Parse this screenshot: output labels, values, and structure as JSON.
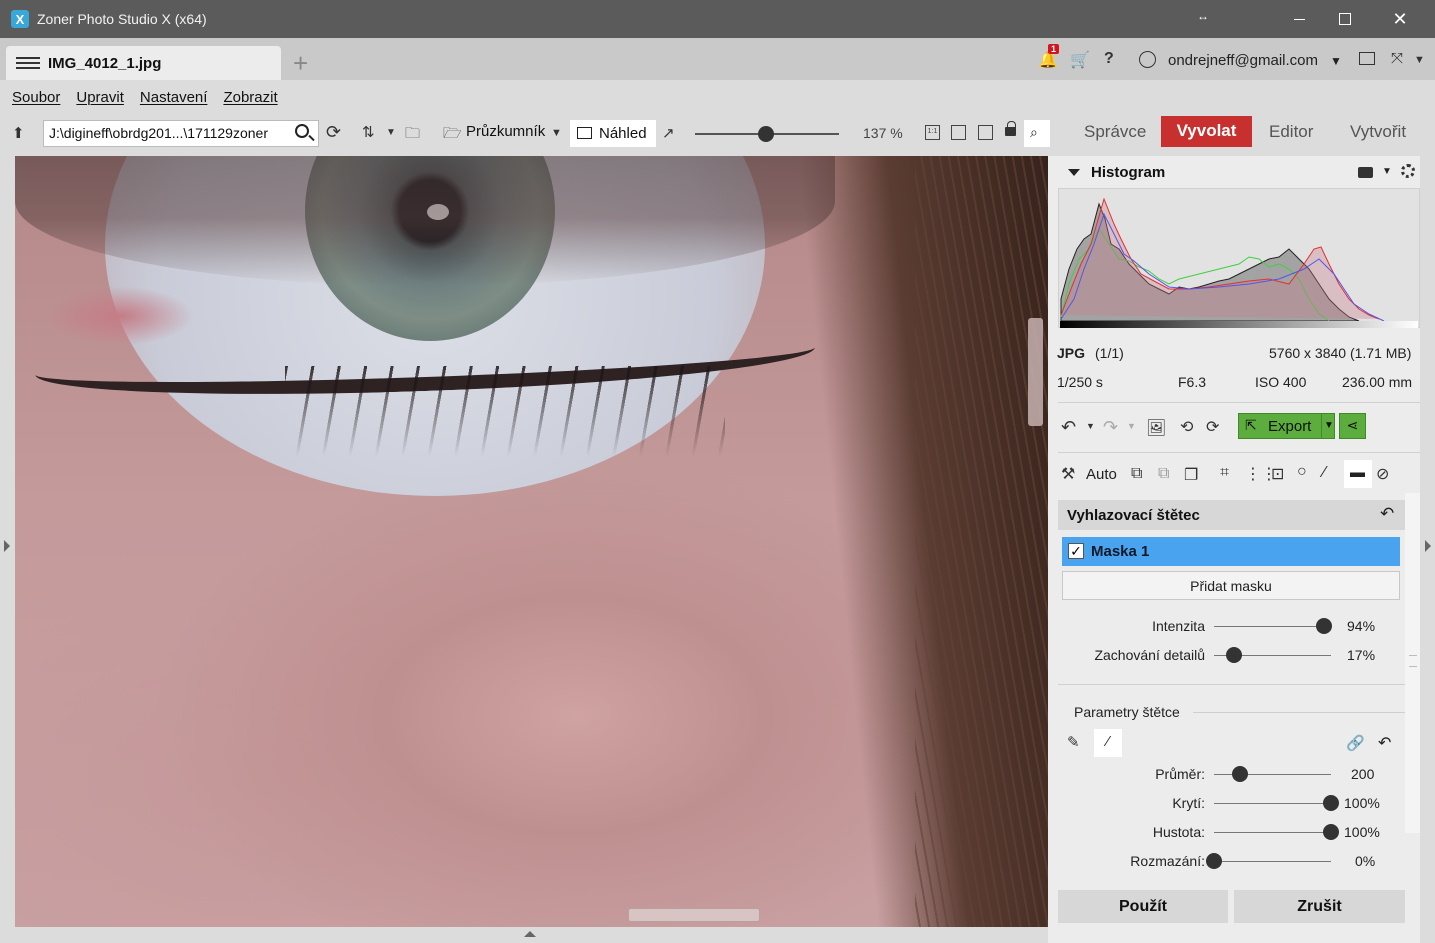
{
  "window": {
    "title": "Zoner Photo Studio X (x64)",
    "logo_letter": "X"
  },
  "tabs": {
    "active_tab": "IMG_4012_1.jpg",
    "new_tab_symbol": "+"
  },
  "account": {
    "notification_count": "1",
    "email": "ondrejneff@gmail.com"
  },
  "menu": [
    "Soubor",
    "Upravit",
    "Nastavení",
    "Zobrazit"
  ],
  "toolbar": {
    "path": "J:\\digineff\\obrdg201...\\171129zoner",
    "browser_label": "Průzkumník",
    "preview_label": "Náhled",
    "zoom_value": "137 %",
    "zoom_fraction": 0.49,
    "actual_size_label": "1:1"
  },
  "modules": {
    "manager": "Správce",
    "develop": "Vyvolat",
    "editor": "Editor",
    "create": "Vytvořit",
    "active": "develop"
  },
  "histogram": {
    "title": "Histogram"
  },
  "file_info": {
    "format": "JPG",
    "index": "(1/1)",
    "dimensions": "5760 x 3840 (1.71 MB)",
    "shutter": "1/250 s",
    "aperture": "F6.3",
    "iso": "ISO 400",
    "focal_length": "236.00 mm"
  },
  "actions": {
    "export_label": "Export",
    "auto_label": "Auto"
  },
  "brush_panel": {
    "title": "Vyhlazovací štětec",
    "mask_label": "Maska 1",
    "mask_checked": "✓",
    "add_mask_label": "Přidat masku",
    "intensity": {
      "label": "Intenzita",
      "value": "94%",
      "level": 0.94
    },
    "detail": {
      "label": "Zachování detailů",
      "value": "17%",
      "level": 0.17
    },
    "params_title": "Parametry štětce",
    "diameter": {
      "label": "Průměr:",
      "value": "200",
      "level": 0.22
    },
    "opacity": {
      "label": "Krytí:",
      "value": "100%",
      "level": 1.0
    },
    "density": {
      "label": "Hustota:",
      "value": "100%",
      "level": 1.0
    },
    "feather": {
      "label": "Rozmazání:",
      "value": "0%",
      "level": 0.0
    },
    "apply_label": "Použít",
    "cancel_label": "Zrušit"
  },
  "colors": {
    "titlebar": "#5b5b5b",
    "develop_active": "#c8302f",
    "export_green": "#5cac3e",
    "mask_selected": "#4aa3ef"
  }
}
